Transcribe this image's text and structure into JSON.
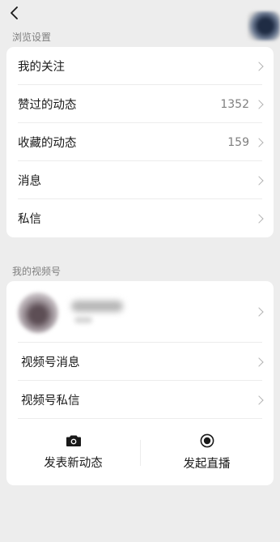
{
  "header": {
    "back_icon": "chevron-left-icon"
  },
  "browse_section": {
    "title": "浏览设置",
    "items": [
      {
        "label": "我的关注",
        "count": ""
      },
      {
        "label": "赞过的动态",
        "count": "1352"
      },
      {
        "label": "收藏的动态",
        "count": "159"
      },
      {
        "label": "消息",
        "count": ""
      },
      {
        "label": "私信",
        "count": ""
      }
    ]
  },
  "channels_section": {
    "title": "我的视频号",
    "items": [
      {
        "label": "视频号消息"
      },
      {
        "label": "视频号私信"
      }
    ],
    "actions": [
      {
        "label": "发表新动态",
        "icon": "camera-icon"
      },
      {
        "label": "发起直播",
        "icon": "record-icon"
      }
    ]
  },
  "colors": {
    "background": "#ededed",
    "card": "#ffffff",
    "secondary_text": "#7f7f7f",
    "chevron": "#b2b2b2"
  }
}
